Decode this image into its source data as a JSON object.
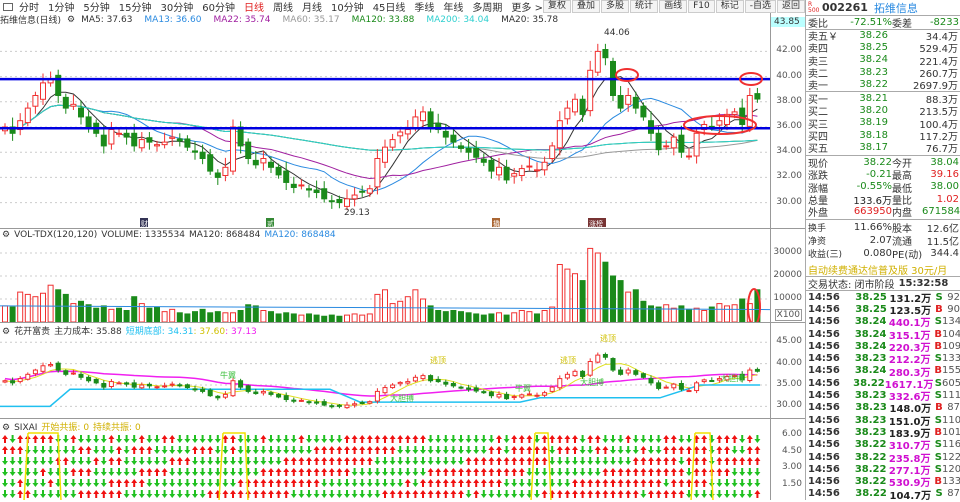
{
  "toolbar": {
    "periods": [
      "分时",
      "1分钟",
      "5分钟",
      "15分钟",
      "30分钟",
      "60分钟",
      "日线",
      "周线",
      "月线",
      "10分钟",
      "45日线",
      "季线",
      "年线",
      "多周期",
      "更多 >"
    ],
    "active": "日线",
    "buttons": [
      "复权",
      "叠加",
      "多股",
      "统计",
      "画线",
      "F10",
      "标记",
      "-自选",
      "返回"
    ]
  },
  "title": {
    "name": "拓维信息(日线)",
    "ma": [
      {
        "label": "MA5: 37.63",
        "color": "#333333"
      },
      {
        "label": "MA13: 36.60",
        "color": "#2a8ae0"
      },
      {
        "label": "MA22: 35.74",
        "color": "#a020a0"
      },
      {
        "label": "MA60: 35.17",
        "color": "#999999"
      },
      {
        "label": "MA120: 33.88",
        "color": "#1a8a1a"
      },
      {
        "label": "MA200: 34.04",
        "color": "#30d0d0"
      },
      {
        "label": "MA20: 35.78",
        "color": "#333333"
      }
    ],
    "top_price": "43.85"
  },
  "main_chart": {
    "yticks": [
      "42.00",
      "40.00",
      "38.00",
      "36.00",
      "34.00",
      "32.00",
      "30.00"
    ],
    "high_label": "44.06",
    "low_label": "29.13",
    "hlines": [
      39.8,
      35.9
    ],
    "markers": [
      "财",
      "贰",
      "撬",
      "涨榜"
    ],
    "closes": [
      36,
      35.5,
      36.5,
      37.5,
      38.5,
      39.5,
      39.8,
      38.5,
      37.5,
      37.8,
      36.8,
      36,
      35.5,
      34.5,
      35.8,
      35.5,
      35.2,
      34.5,
      35,
      34.8,
      34.6,
      34.8,
      35.2,
      34.9,
      34.4,
      34,
      33.5,
      32.5,
      32,
      32.8,
      36,
      34.5,
      33.5,
      33,
      33.5,
      32.8,
      32.2,
      31.6,
      31.2,
      31.4,
      31,
      30.8,
      30.3,
      30.1,
      30,
      30.3,
      30.6,
      30.9,
      31.1,
      33.5,
      34.4,
      35,
      35.6,
      35.8,
      36.8,
      37.2,
      36,
      35.8,
      35.2,
      34.8,
      34.3,
      34,
      33.6,
      33.2,
      32.5,
      32.8,
      31.8,
      32.3,
      32.7,
      32.9,
      32.6,
      33.2,
      34.5,
      36.5,
      37.5,
      38.2,
      37,
      40.5,
      42,
      41.5,
      38.5,
      37.5,
      38.5,
      37.5,
      36.8,
      35.5,
      34.2,
      34.5,
      35.2,
      34,
      33.7,
      35.5,
      36.2,
      36,
      36.5,
      37,
      37.2,
      36.2,
      38.5,
      38.22
    ]
  },
  "volume": {
    "title": "VOL-TDX(120,120)",
    "volume": "VOLUME: 1335534",
    "ma1": "MA120: 868484",
    "ma2": "MA120: 868484",
    "yticks": [
      "30000",
      "20000",
      "10000"
    ],
    "unit": "X100",
    "values": [
      7000,
      6500,
      13000,
      12000,
      11000,
      12500,
      16000,
      14000,
      12000,
      8000,
      9000,
      7500,
      6000,
      7000,
      5500,
      6000,
      5000,
      11000,
      8000,
      6000,
      6500,
      4500,
      5500,
      4000,
      3500,
      4500,
      5500,
      4000,
      4500,
      4000,
      4000,
      5000,
      7500,
      7000,
      5000,
      4500,
      3500,
      4000,
      3500,
      3000,
      3500,
      3000,
      2500,
      3000,
      2500,
      3000,
      3500,
      3000,
      3500,
      12000,
      14000,
      8000,
      9000,
      11000,
      14000,
      10000,
      7000,
      5000,
      4500,
      5000,
      4500,
      4000,
      3500,
      3000,
      3500,
      4000,
      3000,
      4000,
      5000,
      4500,
      3500,
      5000,
      6500,
      25000,
      23000,
      21000,
      18000,
      32000,
      30000,
      26000,
      20000,
      18000,
      13000,
      14000,
      9000,
      7000,
      6500,
      7500,
      6000,
      7000,
      5500,
      6000,
      5000,
      6500,
      8000,
      7000,
      7500,
      10000,
      8000,
      14000
    ]
  },
  "indicator": {
    "title": "花开富贵",
    "cost": "主力成本: 35.88",
    "short_label": "短期底部: 34.31",
    "v2": ": 37.60",
    "v3": ": 37.13",
    "yticks": [
      "45.00",
      "40.00",
      "35.00",
      "30.00"
    ],
    "tags": [
      "逃顶",
      "逃顶",
      "逃顶",
      "大胆搏",
      "大胆搏",
      "牛翼",
      "牛翼",
      "大胆搏"
    ]
  },
  "sixai": {
    "title": "SIXAI",
    "start": "开始共振: 0",
    "continue": "持续共振: 0",
    "yticks": [
      "6.00",
      "4.50",
      "3.00",
      "1.50"
    ]
  },
  "quote": {
    "code": "002261",
    "name": "拓维信息",
    "badge": "R 500",
    "weibi": {
      "label": "委比",
      "value": "-72.51%",
      "label2": "委差",
      "value2": "-8233"
    },
    "sell": [
      {
        "label": "卖五￥",
        "price": "38.26",
        "vol": "34.4万"
      },
      {
        "label": "卖四",
        "price": "38.25",
        "vol": "529.4万"
      },
      {
        "label": "卖三",
        "price": "38.24",
        "vol": "221.4万"
      },
      {
        "label": "卖二",
        "price": "38.23",
        "vol": "260.7万"
      },
      {
        "label": "卖一",
        "price": "38.22",
        "vol": "2697.9万"
      }
    ],
    "buy": [
      {
        "label": "买一",
        "price": "38.21",
        "vol": "88.3万"
      },
      {
        "label": "买二",
        "price": "38.20",
        "vol": "213.5万"
      },
      {
        "label": "买三",
        "price": "38.19",
        "vol": "100.4万"
      },
      {
        "label": "买四",
        "price": "38.18",
        "vol": "117.2万"
      },
      {
        "label": "买五",
        "price": "38.17",
        "vol": "76.7万"
      }
    ],
    "stats": [
      {
        "l1": "现价",
        "v1": "38.22",
        "c1": "g",
        "l2": "今开",
        "v2": "38.04",
        "c2": "g"
      },
      {
        "l1": "涨跌",
        "v1": "-0.21",
        "c1": "g",
        "l2": "最高",
        "v2": "39.16",
        "c2": "r"
      },
      {
        "l1": "涨幅",
        "v1": "-0.55%",
        "c1": "g",
        "l2": "最低",
        "v2": "38.00",
        "c2": "g"
      },
      {
        "l1": "总量",
        "v1": "133.6万",
        "c1": "k",
        "l2": "量比",
        "v2": "1.02",
        "c2": "r"
      },
      {
        "l1": "外盘",
        "v1": "663950",
        "c1": "r",
        "l2": "内盘",
        "v2": "671584",
        "c2": "g"
      }
    ],
    "fund": [
      {
        "l1": "换手",
        "v1": "11.66%",
        "l2": "股本",
        "v2": "12.6亿"
      },
      {
        "l1": "净资",
        "v1": "2.07",
        "l2": "流通",
        "v2": "11.5亿"
      },
      {
        "l1": "收益(三)",
        "v1": "0.080",
        "l2": "PE(动)",
        "v2": "344.4"
      }
    ],
    "ad": "自动续费通达信普及版  30元/月",
    "status": "交易状态: 闭市阶段",
    "status_time": "15:32:58",
    "trades": [
      [
        "14:56",
        "38.25",
        "131.2万",
        "S",
        "92",
        "k"
      ],
      [
        "14:56",
        "38.25",
        "123.5万",
        "B",
        "90",
        "k"
      ],
      [
        "14:56",
        "38.24",
        "440.1万",
        "S",
        "134",
        "m"
      ],
      [
        "14:56",
        "38.24",
        "315.1万",
        "B",
        "104",
        "m"
      ],
      [
        "14:56",
        "38.24",
        "220.3万",
        "B",
        "109",
        "m"
      ],
      [
        "14:56",
        "38.23",
        "212.2万",
        "S",
        "133",
        "m"
      ],
      [
        "14:56",
        "38.24",
        "280.3万",
        "B",
        "155",
        "m"
      ],
      [
        "14:56",
        "38.22",
        "1617.1万",
        "S",
        "605",
        "m"
      ],
      [
        "14:56",
        "38.23",
        "332.6万",
        "S",
        "111",
        "m"
      ],
      [
        "14:56",
        "38.23",
        "148.0万",
        "B",
        "87",
        "k"
      ],
      [
        "14:56",
        "38.23",
        "151.0万",
        "S",
        "110",
        "k"
      ],
      [
        "14:56",
        "38.23",
        "183.9万",
        "B",
        "101",
        "k"
      ],
      [
        "14:56",
        "38.22",
        "310.7万",
        "S",
        "116",
        "m"
      ],
      [
        "14:56",
        "38.22",
        "235.8万",
        "S",
        "122",
        "m"
      ],
      [
        "14:56",
        "38.22",
        "277.1万",
        "S",
        "120",
        "m"
      ],
      [
        "14:56",
        "38.22",
        "530.9万",
        "B",
        "133",
        "m"
      ],
      [
        "14:56",
        "38.22",
        "104.7万",
        "S",
        "87",
        "k"
      ]
    ]
  },
  "colors": {
    "up": "#f03030",
    "down": "#1a8a1a",
    "hline": "#0000e0",
    "annotation": "#f03030"
  }
}
